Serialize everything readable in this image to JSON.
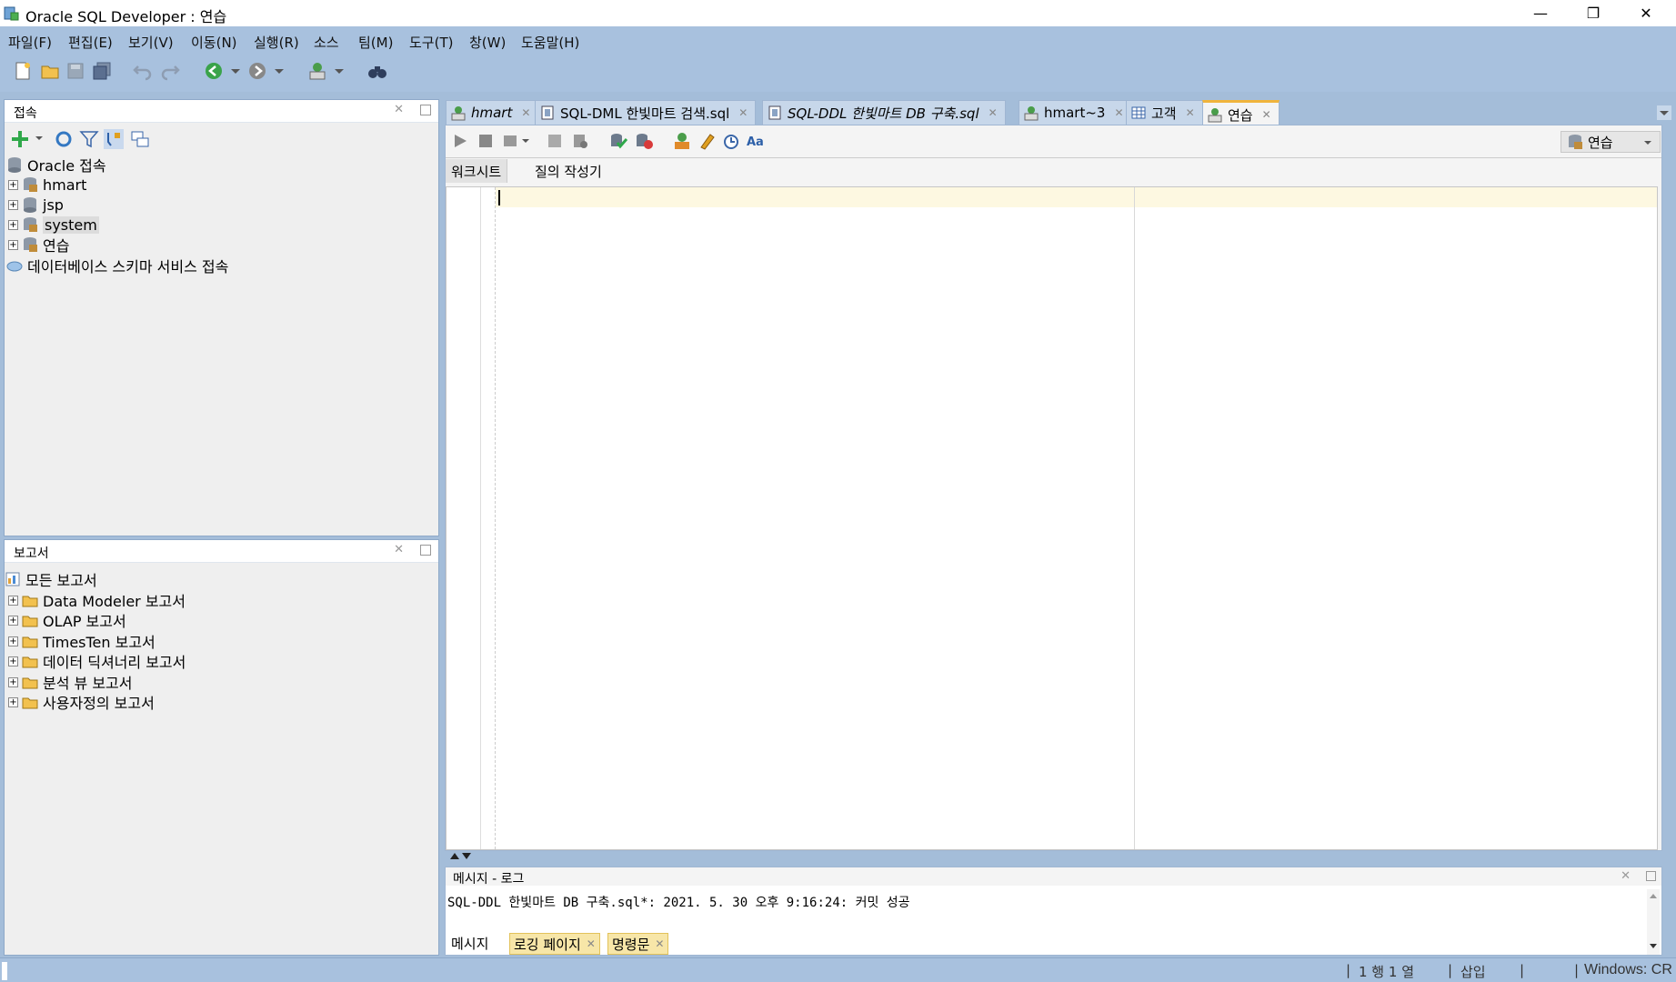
{
  "window": {
    "title": "Oracle SQL Developer : 연습",
    "minimize": "—",
    "restore": "❐",
    "close": "✕"
  },
  "menu": [
    "파일(F)",
    "편집(E)",
    "보기(V)",
    "이동(N)",
    "실행(R)",
    "소스",
    "팀(M)",
    "도구(T)",
    "창(W)",
    "도움말(H)"
  ],
  "connections_panel": {
    "title": "접속",
    "root": "Oracle 접속",
    "items": [
      "hmart",
      "jsp",
      "system",
      "연습"
    ],
    "cloud_item": "데이터베이스 스키마 서비스 접속"
  },
  "reports_panel": {
    "title": "보고서",
    "root": "모든 보고서",
    "items": [
      "Data Modeler 보고서",
      "OLAP 보고서",
      "TimesTen 보고서",
      "데이터 딕셔너리 보고서",
      "분석 뷰 보고서",
      "사용자정의 보고서"
    ]
  },
  "doc_tabs": [
    "hmart",
    "SQL-DML 한빛마트 검색.sql",
    "SQL-DDL 한빛마트 DB 구축.sql",
    "hmart~3",
    "고객",
    "연습"
  ],
  "active_tab": "연습",
  "connection_selector": "연습",
  "editor_subtabs": [
    "워크시트",
    "질의 작성기"
  ],
  "log_panel": {
    "title": "메시지 - 로그",
    "message": "SQL-DDL 한빛마트 DB 구축.sql*: 2021. 5. 30 오후 9:16:24: 커밋 성공",
    "tabs": [
      "메시지",
      "로깅 페이지",
      "명령문"
    ]
  },
  "status": {
    "position": "1 행 1 열",
    "mode": "삽입",
    "line_ending": "Windows: CR"
  },
  "colors": {
    "chrome": "#a8c1de",
    "accent_tab": "#f0b43c",
    "current_line": "#fdf8e1",
    "panel": "#efefef"
  }
}
